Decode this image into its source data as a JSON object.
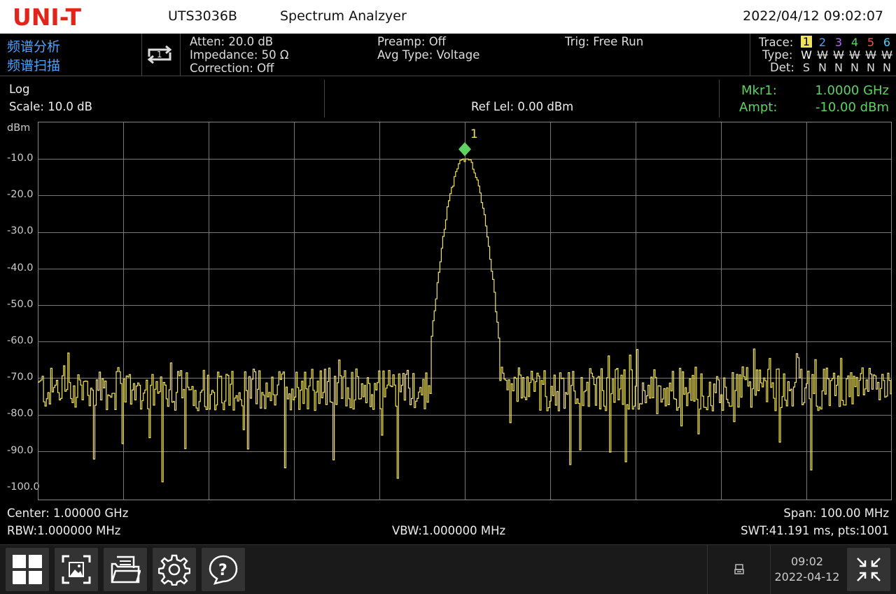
{
  "header": {
    "brand": "UNI-T",
    "model": "UTS3036B",
    "app_title": "Spectrum Analzyer",
    "datetime": "2022/04/12 09:02:07"
  },
  "mode": {
    "line1": "频谱分析",
    "line2": "频谱扫描"
  },
  "settings": {
    "atten": "Atten: 20.0 dB",
    "impedance": "Impedance: 50 Ω",
    "correction": "Correction: Off",
    "preamp": "Preamp: Off",
    "avg_type": "Avg Type: Voltage",
    "trig": "Trig: Free Run"
  },
  "traces": {
    "trace_label": "Trace:",
    "type_label": "Type:",
    "det_label": "Det:",
    "numbers": [
      "1",
      "2",
      "3",
      "4",
      "5",
      "6"
    ],
    "colors": [
      "#f2e35a",
      "#4aa3ff",
      "#b46cff",
      "#5fd35f",
      "#ff5050",
      "#4ad0ff"
    ],
    "types": [
      "W",
      "W",
      "W",
      "W",
      "W",
      "W"
    ],
    "dets": [
      "S",
      "N",
      "N",
      "N",
      "N",
      "N"
    ]
  },
  "scale": {
    "mode": "Log",
    "scale": "Scale: 10.0 dB",
    "ref": "Ref Lel: 0.00 dBm"
  },
  "marker": {
    "label": "Mkr1:",
    "freq": "1.0000 GHz",
    "ampt_label": "Ampt:",
    "ampt": "-10.00 dBm",
    "number": "1"
  },
  "chart_data": {
    "type": "line",
    "ylabel": "dBm",
    "ylim": [
      -100,
      0
    ],
    "yticks": [
      "-10.0",
      "-20.0",
      "-30.0",
      "-40.0",
      "-50.0",
      "-60.0",
      "-70.0",
      "-80.0",
      "-90.0",
      "-100.0"
    ],
    "xlim_ghz": [
      0.95,
      1.05
    ],
    "points": 1001,
    "peak_x_ghz": 1.0,
    "peak_y_dbm": -10.0,
    "noise_floor_dbm": -73,
    "trace_color": "#f2e35a",
    "grid": true
  },
  "footer": {
    "center": "Center: 1.00000 GHz",
    "span": "Span: 100.00 MHz",
    "rbw": "RBW:1.000000 MHz",
    "vbw": "VBW:1.000000 MHz",
    "swt": "SWT:41.191 ms, pts:1001"
  },
  "bottom": {
    "time": "09:02",
    "date": "2022-04-12"
  }
}
